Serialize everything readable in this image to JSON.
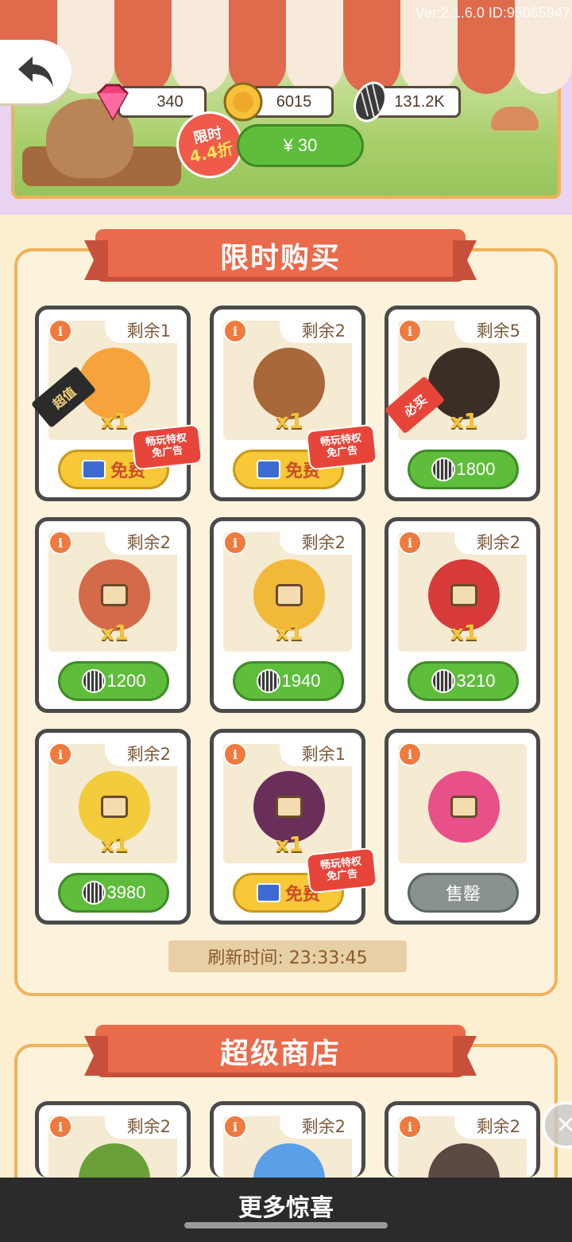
{
  "header": {
    "version": "Ver:2.1.6.0 ID:95065947",
    "currencies": [
      {
        "icon": "gem-icon",
        "value": "340"
      },
      {
        "icon": "coin-icon",
        "value": "6015"
      },
      {
        "icon": "sunflower-seed-icon",
        "value": "131.2K"
      }
    ],
    "deal": {
      "line1": "限时",
      "line2": "4.4折"
    },
    "price": "¥ 30"
  },
  "limited_shop": {
    "title": "限时购买",
    "refresh": "刷新时间: 23:33:45",
    "items": [
      {
        "icon": "piggy-bank-icon",
        "remain": "剩余1",
        "qty": "x1",
        "button": "免费",
        "button_style": "yellow",
        "button_icon": "video-icon",
        "ad_tag": [
          "畅玩特权",
          "免广告"
        ],
        "side_tag": "超值"
      },
      {
        "icon": "acorn-icon",
        "remain": "剩余2",
        "qty": "x1",
        "button": "免费",
        "button_style": "yellow",
        "button_icon": "video-icon",
        "ad_tag": [
          "畅玩特权",
          "免广告"
        ]
      },
      {
        "icon": "cat-food-bag-icon",
        "remain": "剩余5",
        "qty": "x1",
        "button": "1800",
        "button_style": "green",
        "button_icon": "sunflower-seed-icon",
        "side_tag": "必买"
      },
      {
        "icon": "mushroom-locked-icon",
        "remain": "剩余2",
        "qty": "x1",
        "button": "1200",
        "button_style": "green",
        "button_icon": "sunflower-seed-icon"
      },
      {
        "icon": "pumpkin-locked-icon",
        "remain": "剩余2",
        "qty": "x1",
        "button": "1940",
        "button_style": "green",
        "button_icon": "sunflower-seed-icon"
      },
      {
        "icon": "strawberry-locked-icon",
        "remain": "剩余2",
        "qty": "x1",
        "button": "3210",
        "button_style": "green",
        "button_icon": "sunflower-seed-icon"
      },
      {
        "icon": "pineapple-locked-icon",
        "remain": "剩余2",
        "qty": "x1",
        "button": "3980",
        "button_style": "green",
        "button_icon": "sunflower-seed-icon"
      },
      {
        "icon": "mangosteen-locked-icon",
        "remain": "剩余1",
        "qty": "x1",
        "button": "免费",
        "button_style": "yellow",
        "button_icon": "video-icon",
        "ad_tag": [
          "畅玩特权",
          "免广告"
        ]
      },
      {
        "icon": "dragon-fruit-locked-icon",
        "remain": "",
        "qty": "",
        "button": "售罄",
        "button_style": "gray"
      }
    ]
  },
  "super_shop": {
    "title": "超级商店",
    "items": [
      {
        "icon": "flower-bouquet-icon",
        "remain": "剩余2"
      },
      {
        "icon": "blue-flower-icon",
        "remain": "剩余2"
      },
      {
        "icon": "stone-icon",
        "remain": "剩余2"
      }
    ]
  },
  "footer": {
    "label": "更多惊喜"
  },
  "colors": {
    "accent": "#ea6a4c",
    "green": "#5fbd3c",
    "panel_border": "#f0b25a",
    "background": "#fbefcf"
  }
}
